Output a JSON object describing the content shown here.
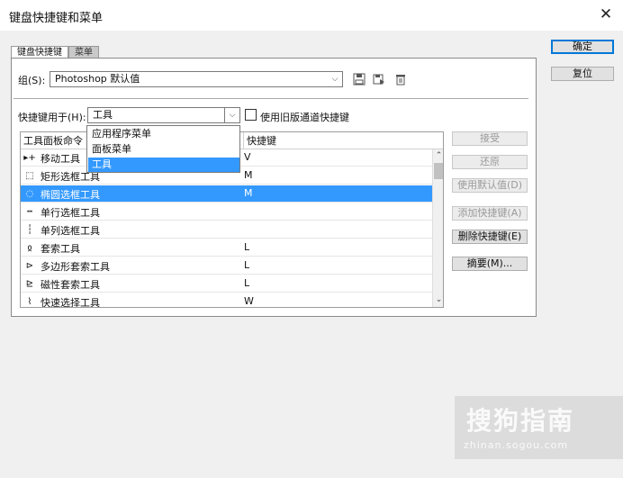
{
  "window": {
    "title": "键盘快捷键和菜单",
    "close_glyph": "✕"
  },
  "right_buttons": {
    "ok": "确定",
    "reset": "复位"
  },
  "tabs": {
    "shortcuts": "键盘快捷键",
    "menus": "菜单"
  },
  "set": {
    "label": "组(S):",
    "value": "Photoshop 默认值"
  },
  "shortcuts_for": {
    "label": "快捷键用于(H):",
    "value": "工具",
    "legacy_checkbox_label": "使用旧版通道快捷键"
  },
  "dropdown_options": [
    "应用程序菜单",
    "面板菜单",
    "工具"
  ],
  "table": {
    "headers": {
      "command": "工具面板命令",
      "shortcut": "快捷键"
    },
    "rows": [
      {
        "name": "移动工具",
        "shortcut": "V",
        "icon": "move-icon",
        "glyph": "▸+"
      },
      {
        "name": "矩形选框工具",
        "shortcut": "M",
        "icon": "rect-marquee-icon",
        "glyph": "⬚"
      },
      {
        "name": "椭圆选框工具",
        "shortcut": "M",
        "icon": "ellipse-marquee-icon",
        "glyph": "◌"
      },
      {
        "name": "单行选框工具",
        "shortcut": "",
        "icon": "single-row-marquee-icon",
        "glyph": "┅"
      },
      {
        "name": "单列选框工具",
        "shortcut": "",
        "icon": "single-column-marquee-icon",
        "glyph": "┆"
      },
      {
        "name": "套索工具",
        "shortcut": "L",
        "icon": "lasso-icon",
        "glyph": "ჲ"
      },
      {
        "name": "多边形套索工具",
        "shortcut": "L",
        "icon": "polygon-lasso-icon",
        "glyph": "⊳"
      },
      {
        "name": "磁性套索工具",
        "shortcut": "L",
        "icon": "magnetic-lasso-icon",
        "glyph": "⊵"
      },
      {
        "name": "快速选择工具",
        "shortcut": "W",
        "icon": "quick-select-icon",
        "glyph": "⌇"
      }
    ],
    "selected_row": 2
  },
  "side_buttons": {
    "accept": "接受",
    "undo": "还原",
    "use_default": "使用默认值(D)",
    "add_shortcut": "添加快捷键(A)",
    "delete_shortcut": "删除快捷键(E)",
    "summarize": "摘要(M)..."
  },
  "scroll": {
    "up": "⌃",
    "down": "⌄"
  },
  "combo_arrow": "⌵",
  "watermark": {
    "brand": "搜狗指南",
    "url": "zhinan.sogou.com"
  }
}
